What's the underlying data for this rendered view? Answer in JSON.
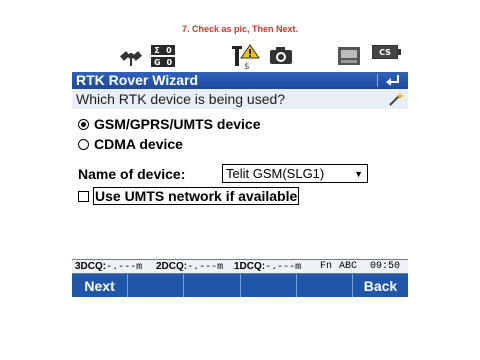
{
  "instruction": "7. Check  as pic, Then Next.",
  "statusbar": {
    "sat_counts": {
      "sigma_label": "Σ",
      "sigma_value": "0",
      "g_label": "G",
      "g_value": "0"
    },
    "battery_label": "CS"
  },
  "title": "RTK Rover Wizard",
  "prompt": "Which RTK device is being used?",
  "options": [
    {
      "label": "GSM/GPRS/UMTS device",
      "selected": true
    },
    {
      "label": "CDMA device",
      "selected": false
    }
  ],
  "device": {
    "label": "Name of device:",
    "selected_value": "Telit GSM(SLG1)"
  },
  "umts": {
    "label": "Use UMTS network if available",
    "checked": false
  },
  "infobar": {
    "dcq3_label": "3DCQ:",
    "dcq3_value": "-.---m",
    "dcq2_label": "2DCQ:",
    "dcq2_value": "-.---m",
    "dcq1_label": "1DCQ:",
    "dcq1_value": "-.---m",
    "fn": "Fn",
    "input_mode": "ABC",
    "time": "09:50"
  },
  "softkeys": [
    "Next",
    "",
    "",
    "",
    "",
    "Back"
  ],
  "colors": {
    "title_bar": "#1c4a9e",
    "softkey_bar": "#1f56a8",
    "instruction": "#c0392b"
  }
}
